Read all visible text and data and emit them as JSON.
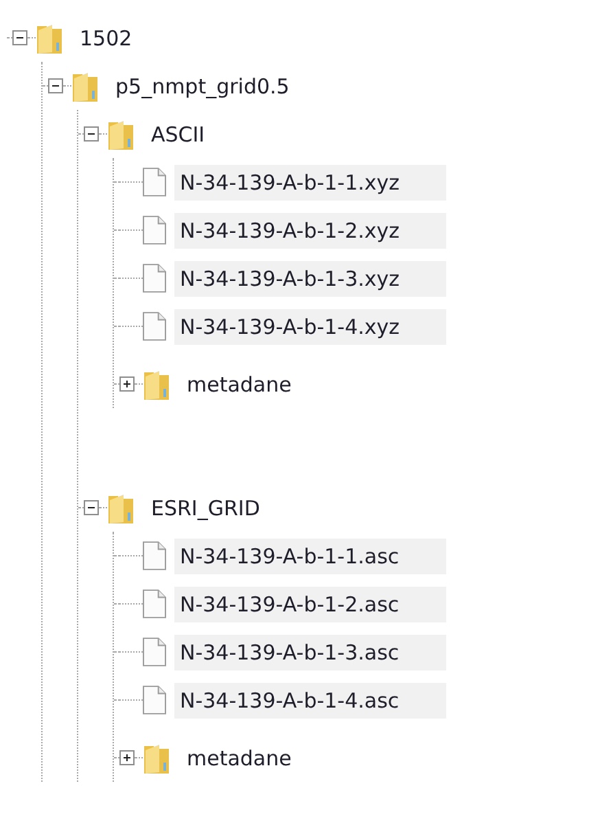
{
  "tree": [
    {
      "kind": "folder",
      "label": "1502",
      "expanded": true,
      "selected": false,
      "children": [
        {
          "kind": "folder",
          "label": "p5_nmpt_grid0.5",
          "expanded": true,
          "selected": false,
          "children": [
            {
              "kind": "folder",
              "label": "ASCII",
              "expanded": true,
              "selected": false,
              "children": [
                {
                  "kind": "file",
                  "label": "N-34-139-A-b-1-1.xyz",
                  "selected": true
                },
                {
                  "kind": "file",
                  "label": "N-34-139-A-b-1-2.xyz",
                  "selected": true
                },
                {
                  "kind": "file",
                  "label": "N-34-139-A-b-1-3.xyz",
                  "selected": true
                },
                {
                  "kind": "file",
                  "label": "N-34-139-A-b-1-4.xyz",
                  "selected": true
                },
                {
                  "kind": "folder",
                  "label": "metadane",
                  "expanded": false,
                  "selected": false
                }
              ]
            },
            {
              "kind": "folder",
              "label": "ESRI_GRID",
              "expanded": true,
              "selected": false,
              "children": [
                {
                  "kind": "file",
                  "label": "N-34-139-A-b-1-1.asc",
                  "selected": true
                },
                {
                  "kind": "file",
                  "label": "N-34-139-A-b-1-2.asc",
                  "selected": true
                },
                {
                  "kind": "file",
                  "label": "N-34-139-A-b-1-3.asc",
                  "selected": true
                },
                {
                  "kind": "file",
                  "label": "N-34-139-A-b-1-4.asc",
                  "selected": true
                },
                {
                  "kind": "folder",
                  "label": "metadane",
                  "expanded": false,
                  "selected": false
                }
              ]
            }
          ]
        }
      ]
    }
  ]
}
